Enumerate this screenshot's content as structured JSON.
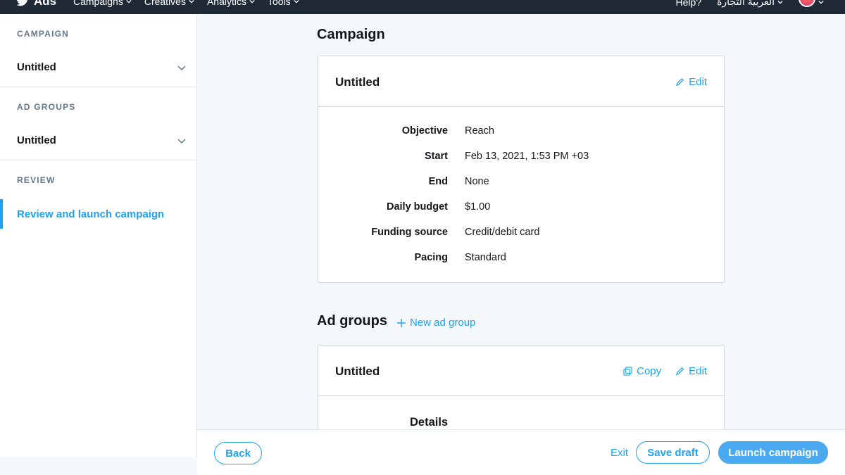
{
  "topbar": {
    "app_name": "Ads",
    "nav": [
      "Campaigns",
      "Creatives",
      "Analytics",
      "Tools"
    ],
    "help": "Help?",
    "language": "العربية التجارة"
  },
  "sidebar": {
    "campaign_heading": "CAMPAIGN",
    "campaign_item": "Untitled",
    "adgroups_heading": "AD GROUPS",
    "adgroups_item": "Untitled",
    "review_heading": "REVIEW",
    "review_item": "Review and launch campaign"
  },
  "campaign": {
    "section_title": "Campaign",
    "card_title": "Untitled",
    "edit_label": "Edit",
    "rows": [
      {
        "key": "Objective",
        "value": "Reach"
      },
      {
        "key": "Start",
        "value": "Feb 13, 2021, 1:53 PM +03"
      },
      {
        "key": "End",
        "value": "None"
      },
      {
        "key": "Daily budget",
        "value": "$1.00"
      },
      {
        "key": "Funding source",
        "value": "Credit/debit card"
      },
      {
        "key": "Pacing",
        "value": "Standard"
      }
    ]
  },
  "adgroups": {
    "section_title": "Ad groups",
    "new_label": "New ad group",
    "card_title": "Untitled",
    "copy_label": "Copy",
    "edit_label": "Edit",
    "details_label": "Details"
  },
  "footer": {
    "back": "Back",
    "exit": "Exit",
    "save_draft": "Save draft",
    "launch": "Launch campaign"
  },
  "colors": {
    "accent": "#1da1f2",
    "topbar": "#1f2a36"
  }
}
